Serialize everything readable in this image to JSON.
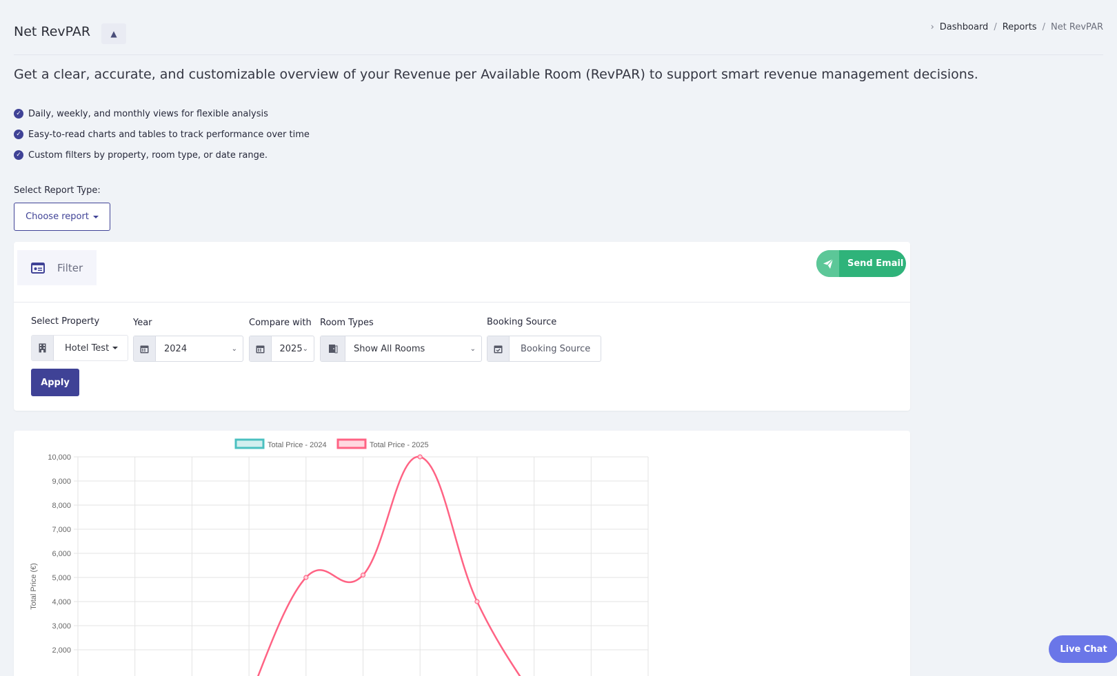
{
  "header": {
    "title": "Net RevPAR",
    "collapse_symbol": "▲",
    "breadcrumb": {
      "items": [
        "Dashboard",
        "Reports"
      ],
      "current": "Net RevPAR"
    }
  },
  "intro": {
    "headline": "Get a clear, accurate, and customizable overview of your Revenue per Available Room (RevPAR) to support smart revenue management decisions.",
    "bullets": [
      "Daily, weekly, and monthly views for flexible analysis",
      "Easy-to-read charts and tables to track performance over time",
      "Custom filters by property, room type, or date range."
    ]
  },
  "report_type": {
    "label": "Select Report Type:",
    "button_label": "Choose report"
  },
  "filter": {
    "tab_label": "Filter",
    "send_email_label": "Send Email",
    "property": {
      "label": "Select Property",
      "value": "Hotel Test"
    },
    "year": {
      "label": "Year",
      "value": "2024"
    },
    "compare": {
      "label": "Compare with",
      "value": "2025"
    },
    "room_types": {
      "label": "Room Types",
      "value": "Show All Rooms"
    },
    "booking_source": {
      "label": "Booking Source",
      "value": "Booking Source"
    },
    "apply_label": "Apply"
  },
  "chart_data": {
    "type": "line",
    "ylabel": "Total Price (€)",
    "ylim": [
      0,
      10000
    ],
    "yticks": [
      2000,
      3000,
      4000,
      5000,
      6000,
      7000,
      8000,
      9000,
      10000
    ],
    "x_count": 11,
    "grid": true,
    "legend_position": "top",
    "series": [
      {
        "name": "Total Price - 2024",
        "color": "#4bc0c0",
        "values": []
      },
      {
        "name": "Total Price - 2025",
        "color": "#ff6384",
        "values": [
          null,
          null,
          null,
          0,
          5000,
          5100,
          10000,
          4000,
          0,
          null,
          null
        ]
      }
    ]
  },
  "live_chat_label": "Live Chat",
  "colors": {
    "primary": "#3f4296",
    "success": "#2fb37a",
    "chat": "#6a76e8"
  }
}
